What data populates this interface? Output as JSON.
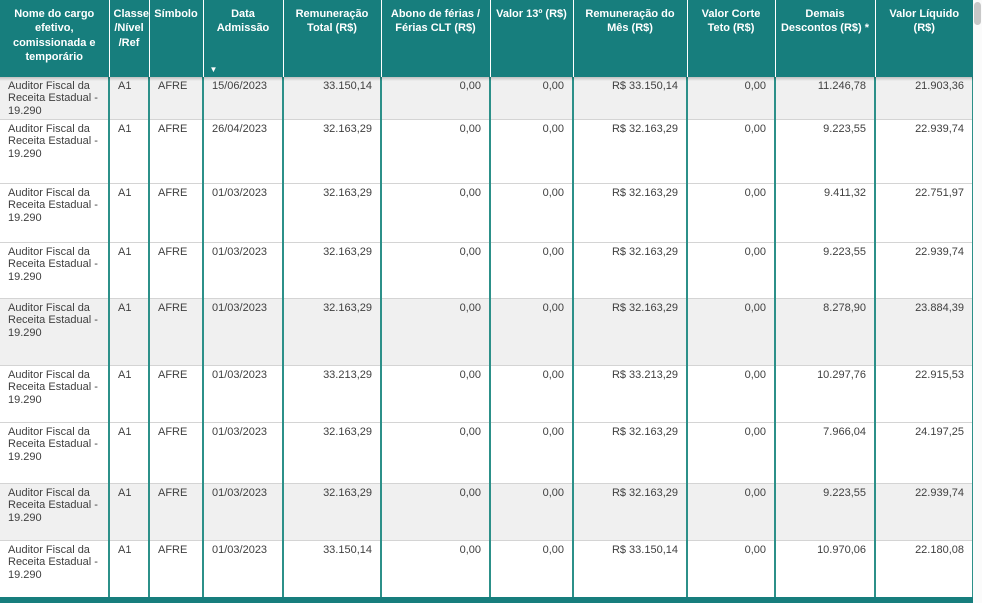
{
  "icons": {
    "sort_desc": "▼"
  },
  "colors": {
    "header_bg": "#177E7D",
    "column_divider": "#2C9089",
    "row_divider": "#D4D4D4",
    "shaded_row_bg": "#F0F0F0",
    "header_text": "#FFFFFF",
    "body_text": "#3F3F3F",
    "scrollbar_thumb": "#C8C8C8"
  },
  "table": {
    "columns": [
      {
        "label": "Nome do cargo efetivo, comissionada e temporário"
      },
      {
        "label": "Classe /Nível /Ref"
      },
      {
        "label": "Símbolo"
      },
      {
        "label": "Data Admissão",
        "sorted": "desc"
      },
      {
        "label": "Remuneração Total (R$)"
      },
      {
        "label": "Abono de férias / Férias CLT (R$)"
      },
      {
        "label": "Valor 13º (R$)"
      },
      {
        "label": "Remuneração do Mês (R$)"
      },
      {
        "label": "Valor Corte Teto (R$)"
      },
      {
        "label": "Demais Descontos (R$) *"
      },
      {
        "label": "Valor Líquido (R$)"
      }
    ],
    "rows": [
      {
        "cargo": "Auditor Fiscal da Receita Estadual - 19.290",
        "classe": "A1",
        "simbolo": "AFRE",
        "data_admissao": "15/06/2023",
        "remuneracao_total": "33.150,14",
        "abono_ferias": "0,00",
        "valor_13": "0,00",
        "remuneracao_mes": "R$ 33.150,14",
        "valor_corte_teto": "0,00",
        "demais_descontos": "11.246,78",
        "valor_liquido": "21.903,36",
        "shaded": true
      },
      {
        "cargo": "Auditor Fiscal da Receita Estadual - 19.290",
        "classe": "A1",
        "simbolo": "AFRE",
        "data_admissao": "26/04/2023",
        "remuneracao_total": "32.163,29",
        "abono_ferias": "0,00",
        "valor_13": "0,00",
        "remuneracao_mes": "R$ 32.163,29",
        "valor_corte_teto": "0,00",
        "demais_descontos": "9.223,55",
        "valor_liquido": "22.939,74",
        "shaded": false
      },
      {
        "cargo": "Auditor Fiscal da Receita Estadual - 19.290",
        "classe": "A1",
        "simbolo": "AFRE",
        "data_admissao": "01/03/2023",
        "remuneracao_total": "32.163,29",
        "abono_ferias": "0,00",
        "valor_13": "0,00",
        "remuneracao_mes": "R$ 32.163,29",
        "valor_corte_teto": "0,00",
        "demais_descontos": "9.411,32",
        "valor_liquido": "22.751,97",
        "shaded": false
      },
      {
        "cargo": "Auditor Fiscal da Receita Estadual - 19.290",
        "classe": "A1",
        "simbolo": "AFRE",
        "data_admissao": "01/03/2023",
        "remuneracao_total": "32.163,29",
        "abono_ferias": "0,00",
        "valor_13": "0,00",
        "remuneracao_mes": "R$ 32.163,29",
        "valor_corte_teto": "0,00",
        "demais_descontos": "9.223,55",
        "valor_liquido": "22.939,74",
        "shaded": false
      },
      {
        "cargo": "Auditor Fiscal da Receita Estadual - 19.290",
        "classe": "A1",
        "simbolo": "AFRE",
        "data_admissao": "01/03/2023",
        "remuneracao_total": "32.163,29",
        "abono_ferias": "0,00",
        "valor_13": "0,00",
        "remuneracao_mes": "R$ 32.163,29",
        "valor_corte_teto": "0,00",
        "demais_descontos": "8.278,90",
        "valor_liquido": "23.884,39",
        "shaded": true
      },
      {
        "cargo": "Auditor Fiscal da Receita Estadual - 19.290",
        "classe": "A1",
        "simbolo": "AFRE",
        "data_admissao": "01/03/2023",
        "remuneracao_total": "33.213,29",
        "abono_ferias": "0,00",
        "valor_13": "0,00",
        "remuneracao_mes": "R$ 33.213,29",
        "valor_corte_teto": "0,00",
        "demais_descontos": "10.297,76",
        "valor_liquido": "22.915,53",
        "shaded": false
      },
      {
        "cargo": "Auditor Fiscal da Receita Estadual - 19.290",
        "classe": "A1",
        "simbolo": "AFRE",
        "data_admissao": "01/03/2023",
        "remuneracao_total": "32.163,29",
        "abono_ferias": "0,00",
        "valor_13": "0,00",
        "remuneracao_mes": "R$ 32.163,29",
        "valor_corte_teto": "0,00",
        "demais_descontos": "7.966,04",
        "valor_liquido": "24.197,25",
        "shaded": false
      },
      {
        "cargo": "Auditor Fiscal da Receita Estadual - 19.290",
        "classe": "A1",
        "simbolo": "AFRE",
        "data_admissao": "01/03/2023",
        "remuneracao_total": "32.163,29",
        "abono_ferias": "0,00",
        "valor_13": "0,00",
        "remuneracao_mes": "R$ 32.163,29",
        "valor_corte_teto": "0,00",
        "demais_descontos": "9.223,55",
        "valor_liquido": "22.939,74",
        "shaded": true
      },
      {
        "cargo": "Auditor Fiscal da Receita Estadual - 19.290",
        "classe": "A1",
        "simbolo": "AFRE",
        "data_admissao": "01/03/2023",
        "remuneracao_total": "33.150,14",
        "abono_ferias": "0,00",
        "valor_13": "0,00",
        "remuneracao_mes": "R$ 33.150,14",
        "valor_corte_teto": "0,00",
        "demais_descontos": "10.970,06",
        "valor_liquido": "22.180,08",
        "shaded": false
      }
    ]
  }
}
